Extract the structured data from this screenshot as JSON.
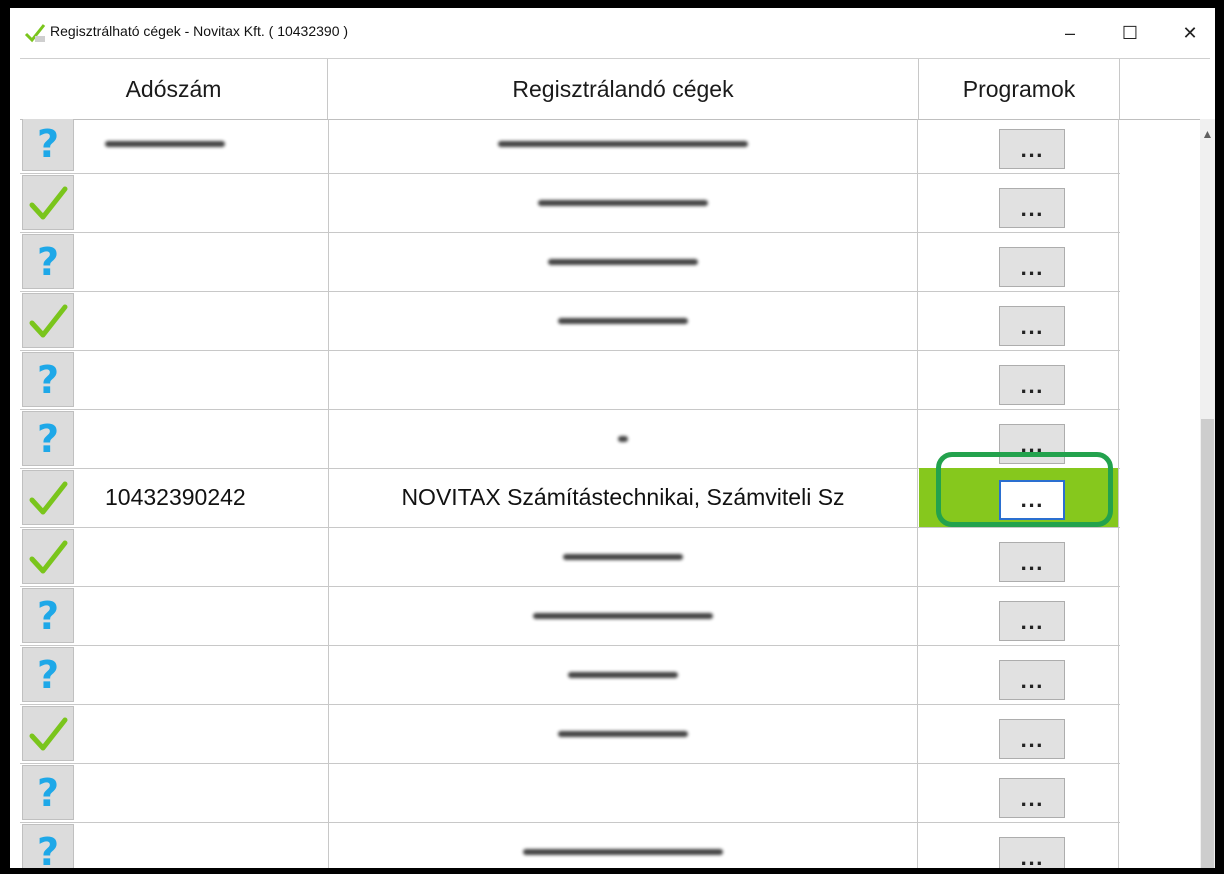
{
  "window": {
    "title": "Regisztrálható cégek - Novitax Kft. ( 10432390 )",
    "minimize_glyph": "–",
    "maximize_glyph": "☐",
    "close_glyph": "✕"
  },
  "table": {
    "columns": [
      "Adószám",
      "Regisztrálandó cégek",
      "Programok"
    ],
    "button_label": "...",
    "rows": [
      {
        "status": "question",
        "ado": "",
        "name": "",
        "blurred": true,
        "selected": false
      },
      {
        "status": "check",
        "ado": "",
        "name": "",
        "blurred": true,
        "selected": false
      },
      {
        "status": "question",
        "ado": "",
        "name": "",
        "blurred": true,
        "selected": false
      },
      {
        "status": "check",
        "ado": "",
        "name": "",
        "blurred": true,
        "selected": false
      },
      {
        "status": "question",
        "ado": "",
        "name": "",
        "blurred": false,
        "selected": false
      },
      {
        "status": "question",
        "ado": "",
        "name": "",
        "blurred": true,
        "selected": false
      },
      {
        "status": "check",
        "ado": "10432390242",
        "name": "NOVITAX Számítástechnikai, Számviteli Sz",
        "blurred": false,
        "selected": true
      },
      {
        "status": "check",
        "ado": "",
        "name": "",
        "blurred": true,
        "selected": false
      },
      {
        "status": "question",
        "ado": "",
        "name": "",
        "blurred": true,
        "selected": false
      },
      {
        "status": "question",
        "ado": "",
        "name": "",
        "blurred": true,
        "selected": false
      },
      {
        "status": "check",
        "ado": "",
        "name": "",
        "blurred": true,
        "selected": false
      },
      {
        "status": "question",
        "ado": "",
        "name": "",
        "blurred": false,
        "selected": false
      },
      {
        "status": "question",
        "ado": "",
        "name": "",
        "blurred": true,
        "selected": false
      }
    ]
  },
  "colors": {
    "check": "#7ac51c",
    "question": "#1ea8e8",
    "selected_row": "#86c81d",
    "highlight_ring": "#23a24d"
  }
}
